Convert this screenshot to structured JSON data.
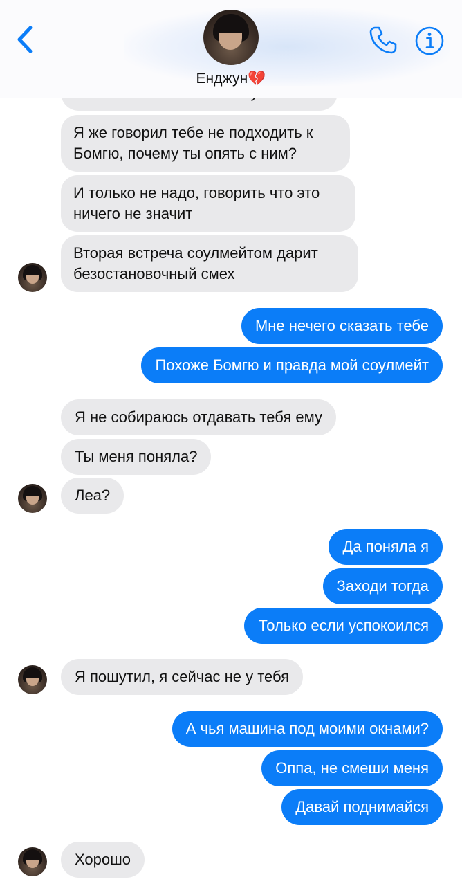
{
  "header": {
    "contact_name": "Енджун💔",
    "back_icon": "chevron-left-icon",
    "phone_icon": "phone-icon",
    "info_icon": "info-icon",
    "accent_color": "#0b7df8"
  },
  "messages": [
    {
      "from": "contact",
      "text": "С тобой спокойно не получается"
    },
    {
      "from": "contact",
      "text": "Я же говорил тебе не подходить к Бомгю, почему ты опять с ним?"
    },
    {
      "from": "contact",
      "text": "И только не надо, говорить что это ничего не значит"
    },
    {
      "from": "contact",
      "text": "Вторая встреча соулмейтом дарит безостановочный смех"
    },
    {
      "from": "me",
      "text": "Мне нечего сказать тебе"
    },
    {
      "from": "me",
      "text": "Похоже Бомгю и правда мой соулмейт"
    },
    {
      "from": "contact",
      "text": "Я не собираюсь отдавать тебя ему"
    },
    {
      "from": "contact",
      "text": "Ты меня поняла?"
    },
    {
      "from": "contact",
      "text": "Леа?"
    },
    {
      "from": "me",
      "text": "Да поняла я"
    },
    {
      "from": "me",
      "text": "Заходи тогда"
    },
    {
      "from": "me",
      "text": "Только если успокоился"
    },
    {
      "from": "contact",
      "text": "Я пошутил, я сейчас не у тебя"
    },
    {
      "from": "me",
      "text": "А чья машина под моими окнами?"
    },
    {
      "from": "me",
      "text": "Оппа, не смеши меня"
    },
    {
      "from": "me",
      "text": "Давай поднимайся"
    },
    {
      "from": "contact",
      "text": "Хорошо"
    }
  ]
}
